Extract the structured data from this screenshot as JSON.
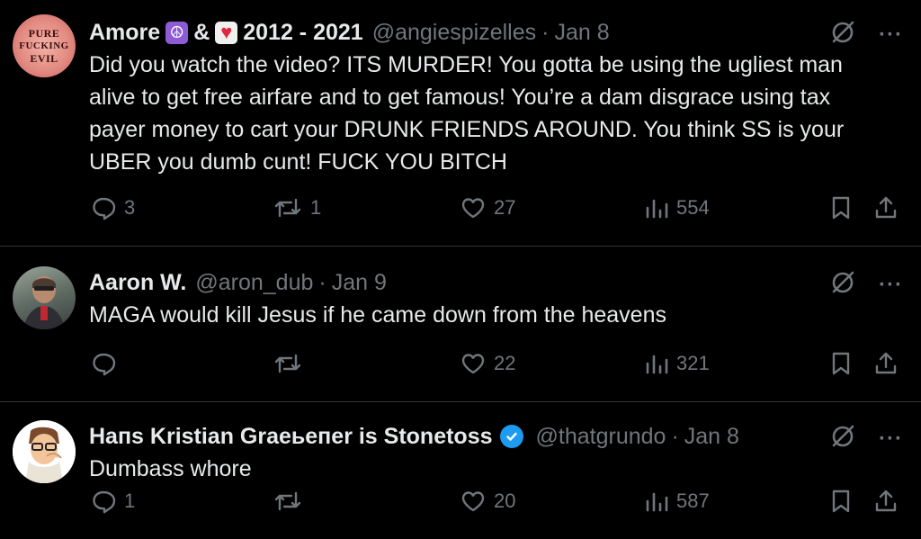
{
  "tweets": [
    {
      "avatar_text": [
        "PURE",
        "FUCKING",
        "EVIL"
      ],
      "name_parts": [
        "Amore",
        "&",
        "2012 - 2021"
      ],
      "emojis": [
        "peace-symbol",
        "heart"
      ],
      "handle": "@angiespizelles",
      "separator": "·",
      "date": "Jan 8",
      "verified": false,
      "text_lines": [
        "Did you watch the video?  ITS MURDER!  You gotta be using the ugliest man",
        "alive to get free airfare and to get famous! You’re a dam disgrace using tax",
        "payer money to cart your DRUNK FRIENDS AROUND.  You think SS is your",
        "UBER you dumb cunt!  FUCK YOU BITCH"
      ],
      "replies": "3",
      "reposts": "1",
      "likes": "27",
      "views": "554"
    },
    {
      "name": "Aaron W.",
      "handle": "@aron_dub",
      "separator": "·",
      "date": "Jan 9",
      "verified": false,
      "text_lines": [
        "MAGA would kill Jesus if he came down from the heavens"
      ],
      "replies": "",
      "reposts": "",
      "likes": "22",
      "views": "321"
    },
    {
      "name": "Haпs Kristian Graeьeпer is Stonetoss",
      "handle": "@thatgrundo",
      "separator": "·",
      "date": "Jan 8",
      "verified": true,
      "text_lines": [
        "Dumbass whore"
      ],
      "replies": "1",
      "reposts": "",
      "likes": "20",
      "views": "587"
    }
  ],
  "colors": {
    "background": "#000000",
    "text": "#e7e9ea",
    "muted": "#71767b",
    "divider": "#2f3336",
    "verified": "#1d9bf0"
  },
  "icons": [
    "grok-icon",
    "more-icon",
    "reply-icon",
    "repost-icon",
    "like-icon",
    "views-icon",
    "bookmark-icon",
    "share-icon",
    "verified-badge-icon"
  ]
}
